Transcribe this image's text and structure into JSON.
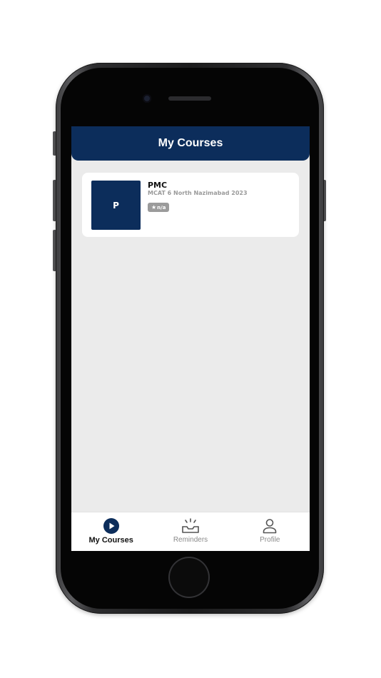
{
  "header": {
    "title": "My Courses"
  },
  "courses": [
    {
      "thumbnail_letter": "P",
      "name": "PMC",
      "subtitle": "MCAT 6 North Nazimabad 2023",
      "rating": "n/a"
    }
  ],
  "tabs": [
    {
      "label": "My Courses",
      "icon": "play-circle-icon",
      "active": true
    },
    {
      "label": "Reminders",
      "icon": "inbox-tray-icon",
      "active": false
    },
    {
      "label": "Profile",
      "icon": "user-icon",
      "active": false
    }
  ],
  "colors": {
    "primary": "#0c2d5b",
    "background": "#ebebeb",
    "card": "#ffffff",
    "muted": "#8a8a8a",
    "badge": "#9b9b9b"
  }
}
